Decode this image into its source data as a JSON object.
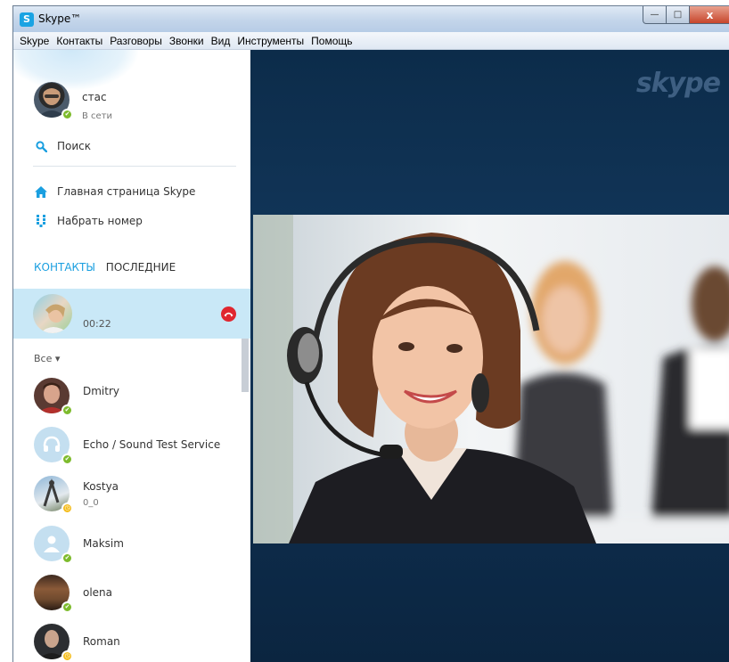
{
  "window": {
    "title": "Skype™",
    "app_icon": "S",
    "minimize": "—",
    "maximize": "□",
    "close": "x"
  },
  "menu": [
    "Skype",
    "Контакты",
    "Разговоры",
    "Звонки",
    "Вид",
    "Инструменты",
    "Помощь"
  ],
  "profile": {
    "name": "стас",
    "status": "В сети"
  },
  "nav": {
    "search": "Поиск",
    "home": "Главная страница Skype",
    "dial": "Набрать номер"
  },
  "tabs": {
    "contacts": "КОНТАКТЫ",
    "recent": "ПОСЛЕДНИЕ"
  },
  "active_call": {
    "duration": "00:22"
  },
  "filter": {
    "label": "Все ▾"
  },
  "contacts": [
    {
      "name": "Dmitry",
      "mood": "",
      "status": "online"
    },
    {
      "name": "Echo / Sound Test Service",
      "mood": "",
      "status": "online"
    },
    {
      "name": "Kostya",
      "mood": "0_0",
      "status": "away"
    },
    {
      "name": "Maksim",
      "mood": "",
      "status": "online"
    },
    {
      "name": "olena",
      "mood": "",
      "status": "online"
    },
    {
      "name": "Roman",
      "mood": "",
      "status": "away"
    }
  ],
  "brand": {
    "logo_text": "skype"
  },
  "colors": {
    "accent": "#1a9fe0",
    "online": "#7dbb2c",
    "away": "#f4bc1b",
    "call_bg": "#c9e8f7",
    "stage_bg": "#0e2d4d",
    "hangup": "#e0262f"
  }
}
